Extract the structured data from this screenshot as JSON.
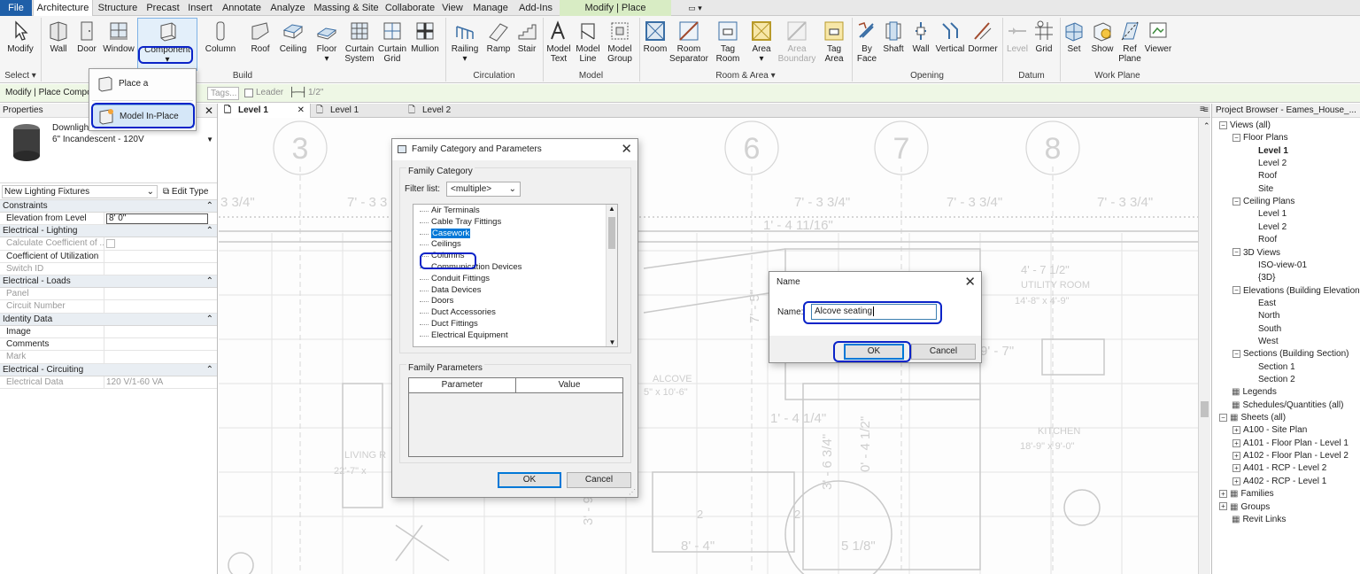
{
  "ribbon_tabs": [
    {
      "label": "File"
    },
    {
      "label": "Architecture"
    },
    {
      "label": "Structure"
    },
    {
      "label": "Precast"
    },
    {
      "label": "Insert"
    },
    {
      "label": "Annotate"
    },
    {
      "label": "Analyze"
    },
    {
      "label": "Massing & Site"
    },
    {
      "label": "Collaborate"
    },
    {
      "label": "View"
    },
    {
      "label": "Manage"
    },
    {
      "label": "Add-Ins"
    },
    {
      "label": "Modify | Place Component"
    }
  ],
  "ribbon": {
    "buttons": {
      "modify": "Modify",
      "wall": "Wall",
      "door": "Door",
      "window": "Window",
      "component": "Component",
      "column": "Column",
      "roof": "Roof",
      "ceiling": "Ceiling",
      "floor": "Floor",
      "curtain_system": "Curtain System",
      "curtain_grid": "Curtain Grid",
      "mullion": "Mullion",
      "railing": "Railing",
      "ramp": "Ramp",
      "stair": "Stair",
      "model_text": "Model Text",
      "model_line": "Model Line",
      "model_group": "Model Group",
      "room": "Room",
      "room_separator": "Room Separator",
      "tag_room": "Tag Room",
      "area": "Area",
      "area_boundary": "Area Boundary",
      "tag_area": "Tag Area",
      "by_face": "By Face",
      "shaft": "Shaft",
      "opening_wall": "Wall",
      "vertical": "Vertical",
      "dormer": "Dormer",
      "level": "Level",
      "grid": "Grid",
      "set": "Set",
      "show": "Show",
      "ref_plane": "Ref Plane",
      "viewer": "Viewer"
    },
    "panels": {
      "select": "Select",
      "build": "Build",
      "circulation": "Circulation",
      "model": "Model",
      "room_area": "Room & Area",
      "opening": "Opening",
      "datum": "Datum",
      "work_plane": "Work Plane"
    },
    "component_menu": [
      "Place a Component",
      "Model In-Place"
    ]
  },
  "options_bar": {
    "context": "Modify | Place Compon",
    "tags_placeholder": "Tags...",
    "leader_label": "Leader",
    "leader_length": "1/2\""
  },
  "properties": {
    "title": "Properties",
    "type_name": "Downlight - Recessed Can",
    "type_sub": "6\" Incandescent - 120V",
    "instance_selector": "New Lighting Fixtures",
    "edit_type": "Edit Type",
    "groups": [
      {
        "name": "Constraints",
        "rows": [
          {
            "k": "Elevation from Level",
            "v": "8' 0\""
          }
        ]
      },
      {
        "name": "Electrical - Lighting",
        "rows": [
          {
            "k": "Calculate Coefficient of ...",
            "v": ""
          },
          {
            "k": "Coefficient of Utilization",
            "v": ""
          },
          {
            "k": "Switch ID",
            "v": ""
          }
        ]
      },
      {
        "name": "Electrical - Loads",
        "rows": [
          {
            "k": "Panel",
            "v": ""
          },
          {
            "k": "Circuit Number",
            "v": ""
          }
        ]
      },
      {
        "name": "Identity Data",
        "rows": [
          {
            "k": "Image",
            "v": ""
          },
          {
            "k": "Comments",
            "v": ""
          },
          {
            "k": "Mark",
            "v": ""
          }
        ]
      },
      {
        "name": "Electrical - Circuiting",
        "rows": [
          {
            "k": "Electrical Data",
            "v": "120 V/1-60 VA"
          }
        ]
      }
    ]
  },
  "view_tabs": [
    "Level 1",
    "Level 1",
    "Level 2"
  ],
  "canvas": {
    "grid_bubbles": [
      "3",
      "6",
      "7",
      "8"
    ],
    "dims": [
      "3 3/4\"",
      "7' - 3 3",
      "7' - 3 3/4\"",
      "7' - 3 3/4\"",
      "7' - 3 3/4\"",
      "1' - 4 11/16\"",
      "7' - 5\"",
      "9' - 7\"",
      "1' - 4 1/4\"",
      "0' - 4 1/2\"",
      "3' - 6 3/4\"",
      "5 1/8\"",
      "8' - 4\"",
      "3' - 9"
    ],
    "rooms": [
      {
        "name": "UTILITY ROOM",
        "size": "4' - 7 1/2\"",
        "area": "14'-8\" x 4'-9\""
      },
      {
        "name": "ALCOVE",
        "area": "5\" x 10'-6\""
      },
      {
        "name": "KITCHEN",
        "area": "18'-9\" x 9'-0\""
      },
      {
        "name": "LIVING R",
        "area": "22'-7\" x"
      }
    ],
    "tags": [
      "2",
      "2"
    ]
  },
  "family_dialog": {
    "title": "Family Category and Parameters",
    "category_group": "Family Category",
    "filter_label": "Filter list:",
    "filter_value": "<multiple>",
    "categories": [
      "Air Terminals",
      "Cable Tray Fittings",
      "Casework",
      "Ceilings",
      "Columns",
      "Communication Devices",
      "Conduit Fittings",
      "Data Devices",
      "Doors",
      "Duct Accessories",
      "Duct Fittings",
      "Electrical Equipment"
    ],
    "selected": "Casework",
    "params_group": "Family Parameters",
    "col_parameter": "Parameter",
    "col_value": "Value",
    "ok": "OK",
    "cancel": "Cancel"
  },
  "name_dialog": {
    "title": "Name",
    "label": "Name:",
    "value": "Alcove seating",
    "ok": "OK",
    "cancel": "Cancel"
  },
  "browser": {
    "title": "Project Browser - Eames_House_...",
    "nodes": [
      {
        "t": "Views (all)",
        "lvl": 0,
        "tog": "-"
      },
      {
        "t": "Floor Plans",
        "lvl": 1,
        "tog": "-"
      },
      {
        "t": "Level 1",
        "lvl": 2,
        "bold": true
      },
      {
        "t": "Level 2",
        "lvl": 2
      },
      {
        "t": "Roof",
        "lvl": 2
      },
      {
        "t": "Site",
        "lvl": 2
      },
      {
        "t": "Ceiling Plans",
        "lvl": 1,
        "tog": "-"
      },
      {
        "t": "Level 1",
        "lvl": 2
      },
      {
        "t": "Level 2",
        "lvl": 2
      },
      {
        "t": "Roof",
        "lvl": 2
      },
      {
        "t": "3D Views",
        "lvl": 1,
        "tog": "-"
      },
      {
        "t": "ISO-view-01",
        "lvl": 2
      },
      {
        "t": "{3D}",
        "lvl": 2
      },
      {
        "t": "Elevations (Building Elevation",
        "lvl": 1,
        "tog": "-"
      },
      {
        "t": "East",
        "lvl": 2
      },
      {
        "t": "North",
        "lvl": 2
      },
      {
        "t": "South",
        "lvl": 2
      },
      {
        "t": "West",
        "lvl": 2
      },
      {
        "t": "Sections (Building Section)",
        "lvl": 1,
        "tog": "-"
      },
      {
        "t": "Section 1",
        "lvl": 2
      },
      {
        "t": "Section 2",
        "lvl": 2
      },
      {
        "t": "Legends",
        "lvl": 0,
        "icon": true
      },
      {
        "t": "Schedules/Quantities (all)",
        "lvl": 0,
        "icon": true
      },
      {
        "t": "Sheets (all)",
        "lvl": 0,
        "tog": "-",
        "icon": true
      },
      {
        "t": "A100 - Site Plan",
        "lvl": 1,
        "tog": "+"
      },
      {
        "t": "A101 - Floor Plan - Level 1",
        "lvl": 1,
        "tog": "+"
      },
      {
        "t": "A102 - Floor Plan - Level 2",
        "lvl": 1,
        "tog": "+"
      },
      {
        "t": "A401 - RCP - Level 2",
        "lvl": 1,
        "tog": "+"
      },
      {
        "t": "A402 - RCP - Level 1",
        "lvl": 1,
        "tog": "+"
      },
      {
        "t": "Families",
        "lvl": 0,
        "tog": "+",
        "icon": true
      },
      {
        "t": "Groups",
        "lvl": 0,
        "tog": "+",
        "icon": true
      },
      {
        "t": "Revit Links",
        "lvl": 0,
        "icon": true
      }
    ]
  },
  "colors": {
    "accent": "#1f5fa8",
    "highlight": "#0a23c8",
    "context_tab": "#d8ecc4",
    "selection": "#0078d7"
  }
}
